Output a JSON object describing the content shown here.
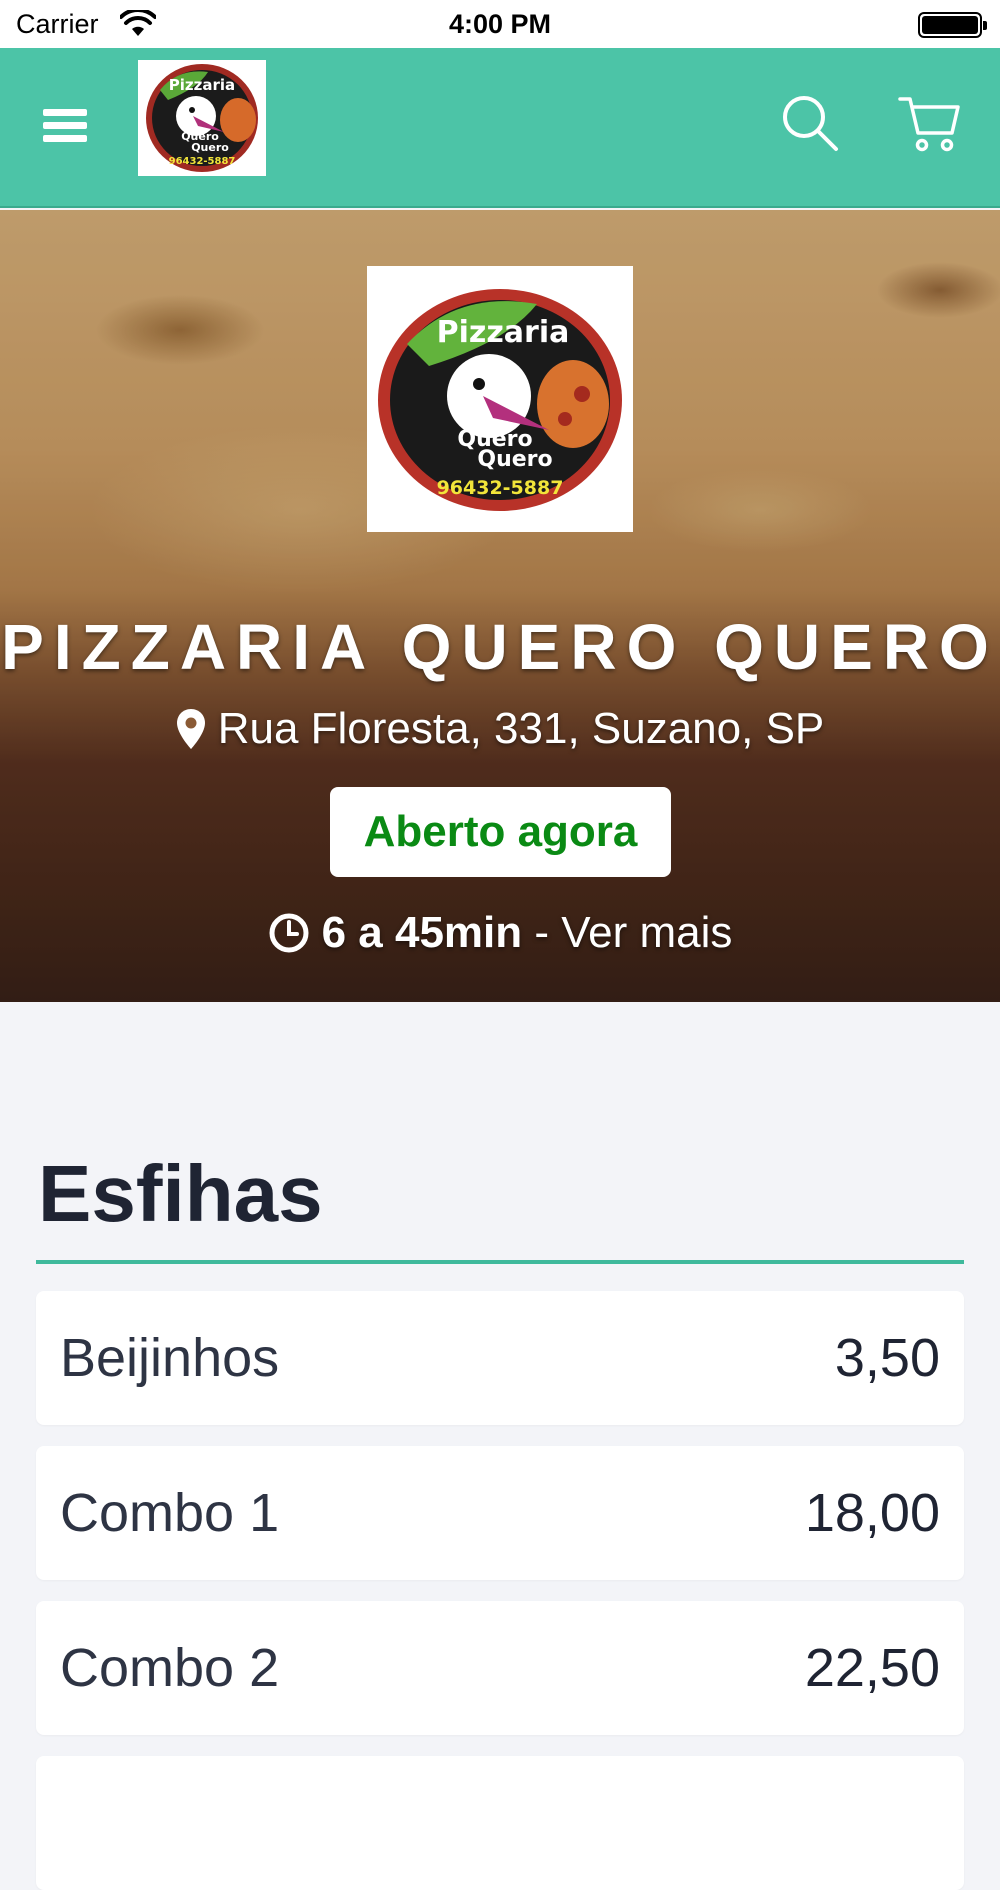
{
  "status_bar": {
    "carrier": "Carrier",
    "time": "4:00 PM"
  },
  "navbar": {
    "background": "#4cc4a7",
    "icons": [
      "menu-icon",
      "search-icon",
      "cart-icon"
    ]
  },
  "logo": {
    "line1": "Pizzaria",
    "line2": "Quero",
    "line3": "Quero",
    "phone": "96432-5887"
  },
  "store": {
    "name": "PIZZARIA QUERO QUERO",
    "address": "Rua Floresta, 331, Suzano, SP",
    "status": "Aberto agora",
    "status_color": "#0a8a14",
    "delivery_time": "6 a 45min",
    "separator": " - ",
    "more_label": "Ver mais"
  },
  "menu": {
    "section_title": "Esfihas",
    "accent": "#3fb99c",
    "items": [
      {
        "name": "Beijinhos",
        "price": "3,50"
      },
      {
        "name": "Combo 1",
        "price": "18,00"
      },
      {
        "name": "Combo 2",
        "price": "22,50"
      }
    ]
  }
}
